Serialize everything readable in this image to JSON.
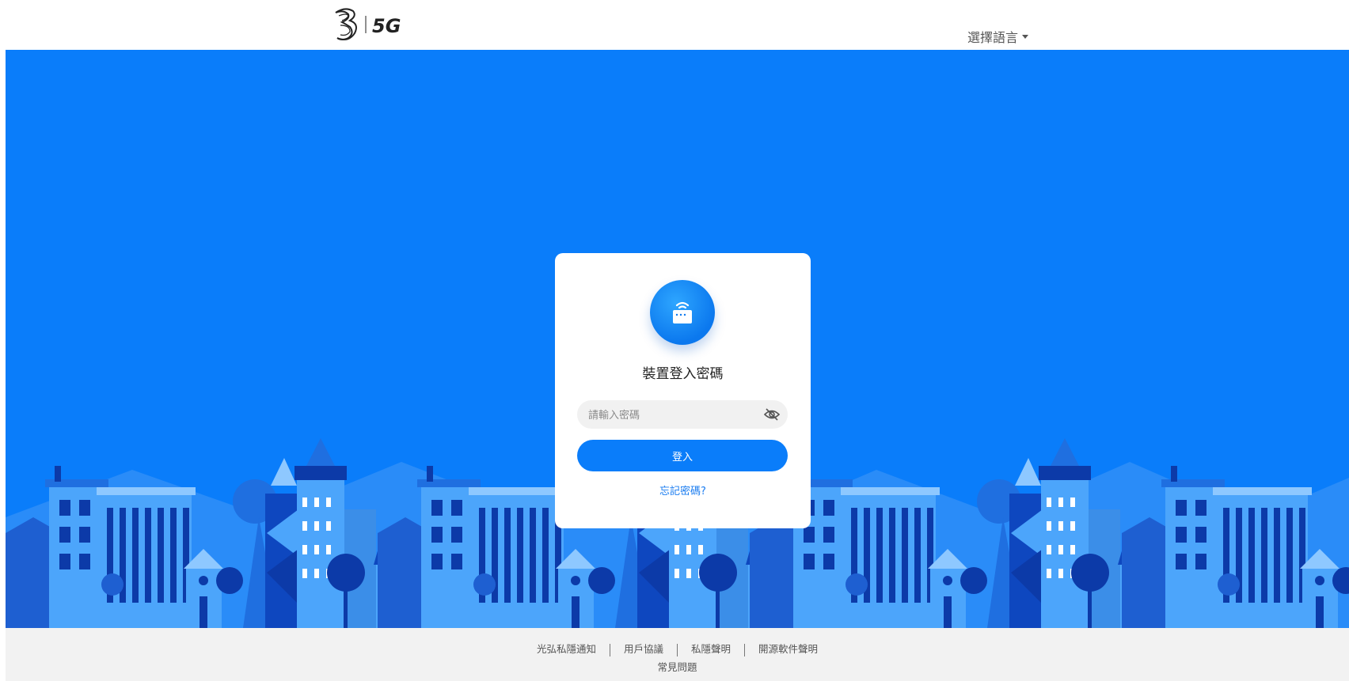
{
  "header": {
    "logo_text": "5G",
    "language_label": "選擇語言"
  },
  "login": {
    "title": "裝置登入密碼",
    "password_placeholder": "請輸入密碼",
    "login_button": "登入",
    "forgot_link": "忘記密碼?"
  },
  "footer": {
    "links": [
      "光弘私隱通知",
      "用戶協議",
      "私隱聲明",
      "開源軟件聲明"
    ],
    "faq": "常見問題"
  },
  "colors": {
    "primary": "#0a7dfa",
    "link": "#1a7cf0"
  },
  "icons": {
    "logo": "three-logo",
    "device": "router-wifi-icon",
    "password_visibility": "eye-slash-icon",
    "language_caret": "caret-down-icon"
  }
}
